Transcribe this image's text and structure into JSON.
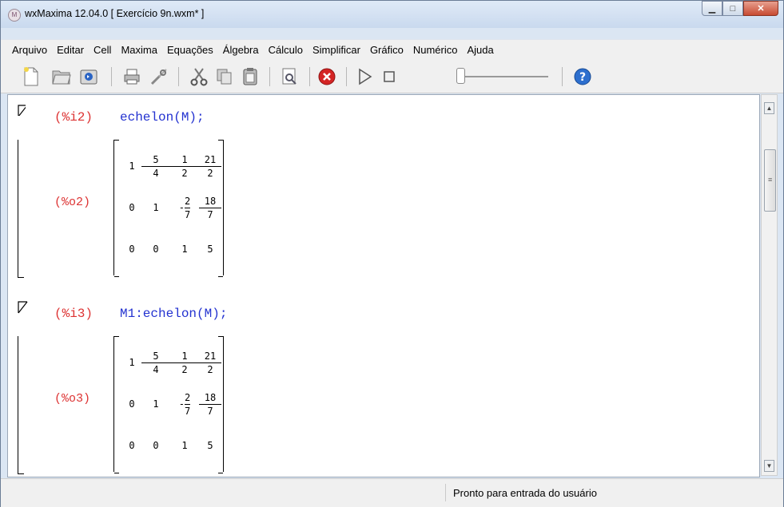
{
  "window": {
    "title": "wxMaxima 12.04.0  [ Exercício 9n.wxm* ]",
    "controls": {
      "minimize": "▁",
      "maximize": "□",
      "close": "✕"
    }
  },
  "menubar": [
    "Arquivo",
    "Editar",
    "Cell",
    "Maxima",
    "Equações",
    "Álgebra",
    "Cálculo",
    "Simplificar",
    "Gráfico",
    "Numérico",
    "Ajuda"
  ],
  "toolbar": {
    "icons": [
      "new-document-icon",
      "open-folder-icon",
      "save-icon",
      "print-icon",
      "preferences-icon",
      "cut-icon",
      "copy-icon",
      "paste-icon",
      "find-icon",
      "interrupt-icon",
      "play-icon",
      "stop-icon",
      "animation-slider",
      "help-icon"
    ]
  },
  "cells": [
    {
      "input_label": "(%i2)",
      "input_code": "echelon(M);",
      "output_label": "(%o2)",
      "matrix": [
        [
          {
            "v": "1"
          },
          {
            "n": "5",
            "d": "4"
          },
          {
            "n": "1",
            "d": "2"
          },
          {
            "n": "21",
            "d": "2"
          }
        ],
        [
          {
            "v": "0"
          },
          {
            "v": "1"
          },
          {
            "s": "-",
            "n": "2",
            "d": "7"
          },
          {
            "n": "18",
            "d": "7"
          }
        ],
        [
          {
            "v": "0"
          },
          {
            "v": "0"
          },
          {
            "v": "1"
          },
          {
            "v": "5"
          }
        ]
      ]
    },
    {
      "input_label": "(%i3)",
      "input_code": "M1:echelon(M);",
      "output_label": "(%o3)",
      "matrix": [
        [
          {
            "v": "1"
          },
          {
            "n": "5",
            "d": "4"
          },
          {
            "n": "1",
            "d": "2"
          },
          {
            "n": "21",
            "d": "2"
          }
        ],
        [
          {
            "v": "0"
          },
          {
            "v": "1"
          },
          {
            "s": "-",
            "n": "2",
            "d": "7"
          },
          {
            "n": "18",
            "d": "7"
          }
        ],
        [
          {
            "v": "0"
          },
          {
            "v": "0"
          },
          {
            "v": "1"
          },
          {
            "v": "5"
          }
        ]
      ]
    }
  ],
  "status": "Pronto para entrada do usuário",
  "colors": {
    "input_label": "#d33333",
    "input_code": "#2332d0",
    "output_label": "#d33333"
  }
}
